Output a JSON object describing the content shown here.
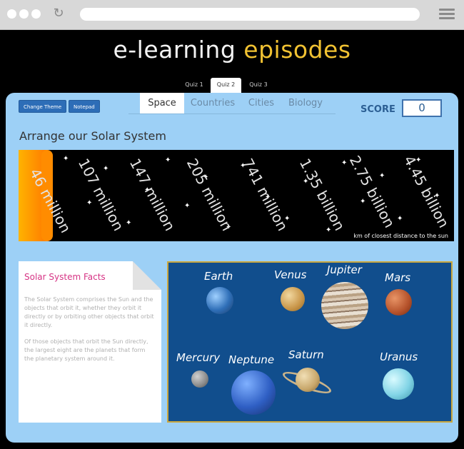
{
  "header": {
    "title_part1": "e-learning",
    "title_part2": "episodes"
  },
  "quiz_tabs": [
    {
      "label": "Quiz 1",
      "active": false
    },
    {
      "label": "Quiz 2",
      "active": true
    },
    {
      "label": "Quiz 3",
      "active": false
    }
  ],
  "toolbar": {
    "change_theme": "Change Theme",
    "notepad": "Notepad"
  },
  "subject_tabs": [
    {
      "label": "Space",
      "active": true
    },
    {
      "label": "Countries",
      "active": false
    },
    {
      "label": "Cities",
      "active": false
    },
    {
      "label": "Biology",
      "active": false
    }
  ],
  "score": {
    "label": "SCORE",
    "value": "0"
  },
  "activity": {
    "heading": "Arrange our Solar System",
    "distances": [
      "46 million",
      "107 million",
      "147 million",
      "205 million",
      "741 million",
      "1.35 billion",
      "2.75 billion",
      "4.45 billion"
    ],
    "note": "km of closest distance to the sun"
  },
  "facts": {
    "title": "Solar System Facts",
    "p1": "The Solar System comprises the Sun and the objects that orbit it, whether they orbit it directly or by orbiting other objects that orbit it directly.",
    "p2": "Of those objects that orbit the Sun directly, the largest eight are the planets that form the planetary system around it."
  },
  "planets": [
    "Earth",
    "Venus",
    "Jupiter",
    "Mars",
    "Mercury",
    "Neptune",
    "Saturn",
    "Uranus"
  ],
  "colors": {
    "accent": "#f1c232",
    "panel": "#9dd0f6",
    "board": "#114e8d",
    "button": "#2d6db7"
  }
}
